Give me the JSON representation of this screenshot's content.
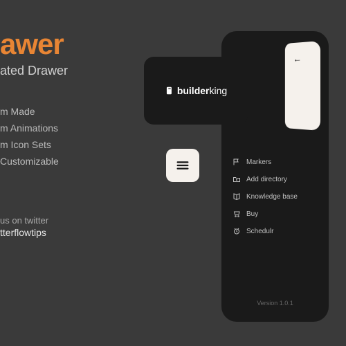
{
  "hero": {
    "title": "awer",
    "subtitle": "ated Drawer"
  },
  "features": [
    "m Made",
    "m Animations",
    "m Icon Sets",
    "Customizable"
  ],
  "social": {
    "line1": "us on twitter",
    "line2": "tterflowtips"
  },
  "brand": {
    "name1": "builder",
    "name2": "king"
  },
  "drawer": {
    "items": [
      {
        "icon": "flag",
        "label": "Markers"
      },
      {
        "icon": "folder",
        "label": "Add directory"
      },
      {
        "icon": "book",
        "label": "Knowledge base"
      },
      {
        "icon": "cart",
        "label": "Buy"
      },
      {
        "icon": "clock",
        "label": "Schedulr"
      }
    ],
    "version": "Version 1.0.1"
  }
}
